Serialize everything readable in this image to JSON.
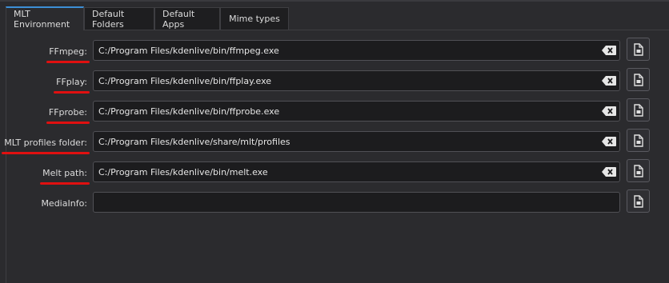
{
  "tabs": [
    {
      "label": "MLT Environment",
      "active": true
    },
    {
      "label": "Default Folders",
      "active": false
    },
    {
      "label": "Default Apps",
      "active": false
    },
    {
      "label": "Mime types",
      "active": false
    }
  ],
  "fields": [
    {
      "label": "FFmpeg:",
      "value": "C:/Program Files/kdenlive/bin/ffmpeg.exe",
      "highlighted": true
    },
    {
      "label": "FFplay:",
      "value": "C:/Program Files/kdenlive/bin/ffplay.exe",
      "highlighted": true
    },
    {
      "label": "FFprobe:",
      "value": "C:/Program Files/kdenlive/bin/ffprobe.exe",
      "highlighted": true
    },
    {
      "label": "MLT profiles folder:",
      "value": "C:/Program Files/kdenlive/share/mlt/profiles",
      "highlighted": true
    },
    {
      "label": "Melt path:",
      "value": "C:/Program Files/kdenlive/bin/melt.exe",
      "highlighted": true
    },
    {
      "label": "MediaInfo:",
      "value": "",
      "highlighted": false
    }
  ],
  "icons": {
    "clear": "clear-text-icon",
    "browse": "open-file-icon"
  },
  "colors": {
    "accent": "#3d8fd6",
    "highlight": "#e01010",
    "background": "#2b2b2e",
    "field_bg": "#1c1c1e"
  }
}
